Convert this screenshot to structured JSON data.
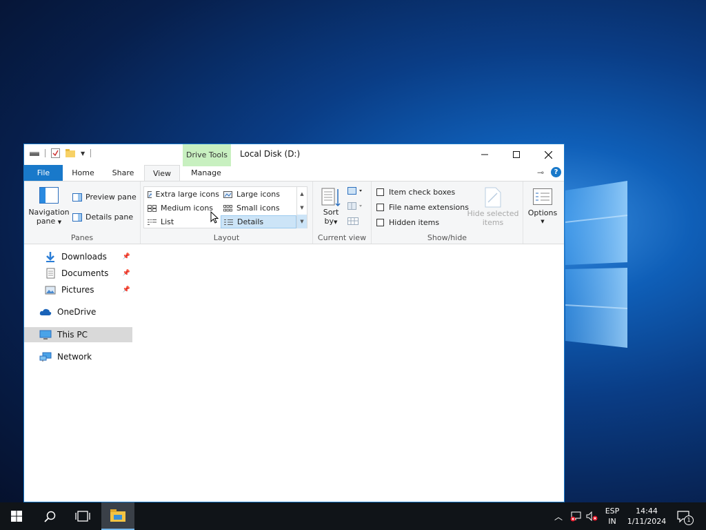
{
  "window": {
    "title": "Local Disk (D:)",
    "context_tab": "Drive Tools"
  },
  "tabs": [
    "File",
    "Home",
    "Share",
    "View",
    "Manage"
  ],
  "ribbon": {
    "panes": {
      "navigation_pane": "Navigation",
      "navigation_pane_2": "pane",
      "preview_pane": "Preview pane",
      "details_pane": "Details pane",
      "label": "Panes"
    },
    "layout": {
      "items": [
        "Extra large icons",
        "Large icons",
        "Medium icons",
        "Small icons",
        "List",
        "Details"
      ],
      "selected": "Details",
      "label": "Layout"
    },
    "current_view": {
      "sort_by": "Sort",
      "sort_by_2": "by",
      "label": "Current view"
    },
    "show_hide": {
      "item_check_boxes": "Item check boxes",
      "file_name_extensions": "File name extensions",
      "hidden_items": "Hidden items",
      "hide_selected_items": "Hide selected",
      "hide_selected_items_2": "items",
      "label": "Show/hide"
    },
    "options": "Options"
  },
  "nav": {
    "downloads": "Downloads",
    "documents": "Documents",
    "pictures": "Pictures",
    "onedrive": "OneDrive",
    "this_pc": "This PC",
    "network": "Network"
  },
  "taskbar": {
    "language": "ESP",
    "language_2": "IN",
    "time": "14:44",
    "date": "1/11/2024",
    "notification_count": "1"
  },
  "colors": {
    "accent": "#1979ca",
    "drive_tools": "#c8f0c0",
    "selected": "#cce4f7"
  }
}
